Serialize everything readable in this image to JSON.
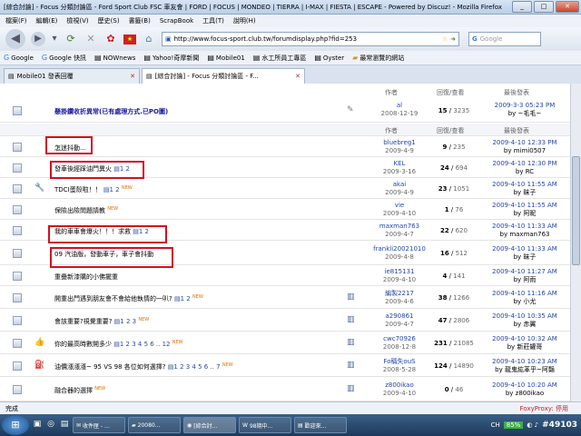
{
  "window": {
    "title": "[綜合討論] - Focus 分類討論區 - Ford Sport Club FSC 車友會 | FORD | FOCUS | MONDEO | TIERRA | I-MAX | FIESTA | ESCAPE - Powered by Discuz! - Mozilla Firefox"
  },
  "menu": [
    "檔案(F)",
    "編輯(E)",
    "檢視(V)",
    "歷史(S)",
    "書籤(B)",
    "ScrapBook",
    "工具(T)",
    "說明(H)"
  ],
  "nav": {
    "url": "http://www.focus-sport.club.tw/forumdisplay.php?fid=253",
    "search_placeholder": "Google",
    "search_label": "G"
  },
  "bookmarks": [
    "Google",
    "Google 快訊",
    "NOWnews",
    "Yahoo!奇摩新聞",
    "Mobile01",
    "水工所員工專區",
    "Oyster",
    "最常瀏覽的網站"
  ],
  "tabs": [
    "Mobile01 發表回覆",
    "[綜合討論] - Focus 分類討論區 - F..."
  ],
  "header": {
    "author": "作者",
    "replies": "回復/查看",
    "last": "最後發表"
  },
  "rows": [
    {
      "subject": "懸掛鑽收折異常(已有處理方式.已PO圖)",
      "pages": "",
      "new": "",
      "author": "al",
      "date": "2008-12-19",
      "replies": "15",
      "views": "3235",
      "last_time": "2009-3-3 05:23 PM",
      "last_by": "by ~毛毛~"
    },
    {
      "subject": "怎迷抖動...",
      "pages": "",
      "new": "",
      "author": "bluebreg1",
      "date": "2009-4-9",
      "replies": "9",
      "views": "235",
      "last_time": "2009-4-10 12:33 PM",
      "last_by": "by mimi0507"
    },
    {
      "subject": "發車後經踩油門異火",
      "pages": "1 2",
      "new": "",
      "author": "KEL",
      "date": "2009-3-16",
      "replies": "24",
      "views": "694",
      "last_time": "2009-4-10 12:30 PM",
      "last_by": "by RC"
    },
    {
      "subject": "TDCI蛋殼啦！！",
      "pages": "1 2",
      "new": "NEW",
      "author": "akai",
      "date": "2009-4-9",
      "replies": "23",
      "views": "1051",
      "last_time": "2009-4-10 11:55 AM",
      "last_by": "by 昧子"
    },
    {
      "subject": "保險出險問題請教",
      "pages": "",
      "new": "NEW",
      "author": "vie",
      "date": "2009-4-10",
      "replies": "1",
      "views": "76",
      "last_time": "2009-4-10 11:55 AM",
      "last_by": "by 阿昵"
    },
    {
      "subject": "我的車車會爆火！！！求救",
      "pages": "1 2",
      "new": "",
      "author": "maxman763",
      "date": "2009-4-7",
      "replies": "22",
      "views": "620",
      "last_time": "2009-4-10 11:33 AM",
      "last_by": "by maxman763"
    },
    {
      "subject": "09 汽油版，發動車子，車子會抖動",
      "pages": "",
      "new": "",
      "author": "frankli20021010",
      "date": "2009-4-8",
      "replies": "16",
      "views": "512",
      "last_time": "2009-4-10 11:33 AM",
      "last_by": "by 昧子"
    },
    {
      "subject": "重疊新漆購的小佛擺重",
      "pages": "",
      "new": "",
      "author": "ie815131",
      "date": "2009-4-10",
      "replies": "4",
      "views": "141",
      "last_time": "2009-4-10 11:27 AM",
      "last_by": "by 阿雨"
    },
    {
      "subject": "開重出門遇到朋友會不會給他執情的一叭?",
      "pages": "1 2",
      "new": "NEW",
      "author": "編製2217",
      "date": "2009-4-6",
      "replies": "38",
      "views": "1266",
      "last_time": "2009-4-10 11:16 AM",
      "last_by": "by 小尤"
    },
    {
      "subject": "會該重要?視覺重要?",
      "pages": "1 2 3",
      "new": "NEW",
      "author": "a290861",
      "date": "2009-4-7",
      "replies": "47",
      "views": "2806",
      "last_time": "2009-4-10 10:35 AM",
      "last_by": "by 赤翼"
    },
    {
      "subject": "你的最高時數開多少",
      "pages": "1 2 3 4 5 6 .. 12",
      "new": "NEW",
      "author": "cwc70926",
      "date": "2008-12-8",
      "replies": "231",
      "views": "21085",
      "last_time": "2009-4-10 10:32 AM",
      "last_by": "by 新莊罐哥"
    },
    {
      "subject": "油價漲漲漲~ 95 VS 98 各位如何選擇?",
      "pages": "1 2 3 4 5 6 .. 7",
      "new": "NEW",
      "author": "Fo稱失ouS",
      "date": "2008-5-28",
      "replies": "124",
      "views": "14890",
      "last_time": "2009-4-10 10:23 AM",
      "last_by": "by 龍鬼紘革乎~阿豔"
    },
    {
      "subject": "融合器的選擇",
      "pages": "",
      "new": "NEW",
      "author": "z800ikao",
      "date": "2009-4-10",
      "replies": "0",
      "views": "46",
      "last_time": "2009-4-10 10:20 AM",
      "last_by": "by z800ikao"
    }
  ],
  "status": {
    "left": "完成",
    "proxy": "FoxyProxy: 停用"
  },
  "taskbar": {
    "items": [
      "收件匣 - ...",
      "20080...",
      "[綜合討...",
      "98期中...",
      "歡迎來..."
    ],
    "lang": "CH",
    "battery": "85%",
    "watermark": "#49103"
  }
}
